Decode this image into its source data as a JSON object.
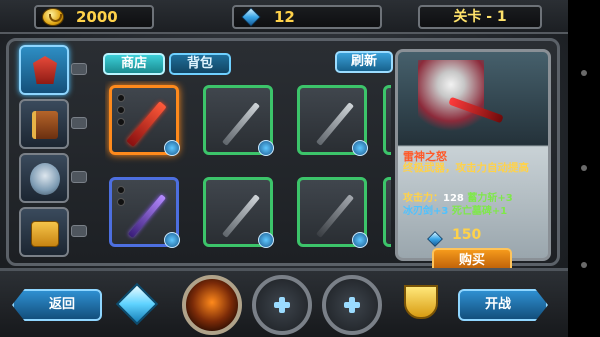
{
  "resources": {
    "gold": "2000",
    "crystals": "12",
    "level_label": "关卡 - 1"
  },
  "tabs": {
    "shop": "商店",
    "bag": "背包",
    "refresh": "刷新"
  },
  "sidebar": {
    "items": [
      {
        "name": "emblem",
        "active": true
      },
      {
        "name": "book",
        "active": false
      },
      {
        "name": "hero",
        "active": false
      },
      {
        "name": "gift",
        "active": false
      }
    ]
  },
  "grid": {
    "slots": [
      {
        "weapon": "red-sword",
        "selected": true
      },
      {
        "weapon": "steel-spear",
        "selected": false
      },
      {
        "weapon": "steel-sword",
        "selected": false
      },
      {
        "weapon": "purple-sword",
        "selected": false
      },
      {
        "weapon": "steel-spear",
        "selected": false
      },
      {
        "weapon": "dark-sword",
        "selected": false
      }
    ]
  },
  "detail": {
    "name": "雷神之怒",
    "description": "终极武器，攻击力自动提高",
    "attack_label": "攻击力：",
    "attack_value": "128",
    "storm_label": "蓄力斩+3",
    "blade_label": "冰刃剑+3",
    "death_label": "死亡墓碑+1",
    "price": "150",
    "buy_label": "购买"
  },
  "bottom": {
    "back_label": "返回",
    "start_label": "开战"
  },
  "colors": {
    "gold_text": "#ffd24a",
    "selected_border": "#ff8a1c",
    "slot_border": "#3cc46a",
    "accent_blue": "#2f8fd0"
  }
}
